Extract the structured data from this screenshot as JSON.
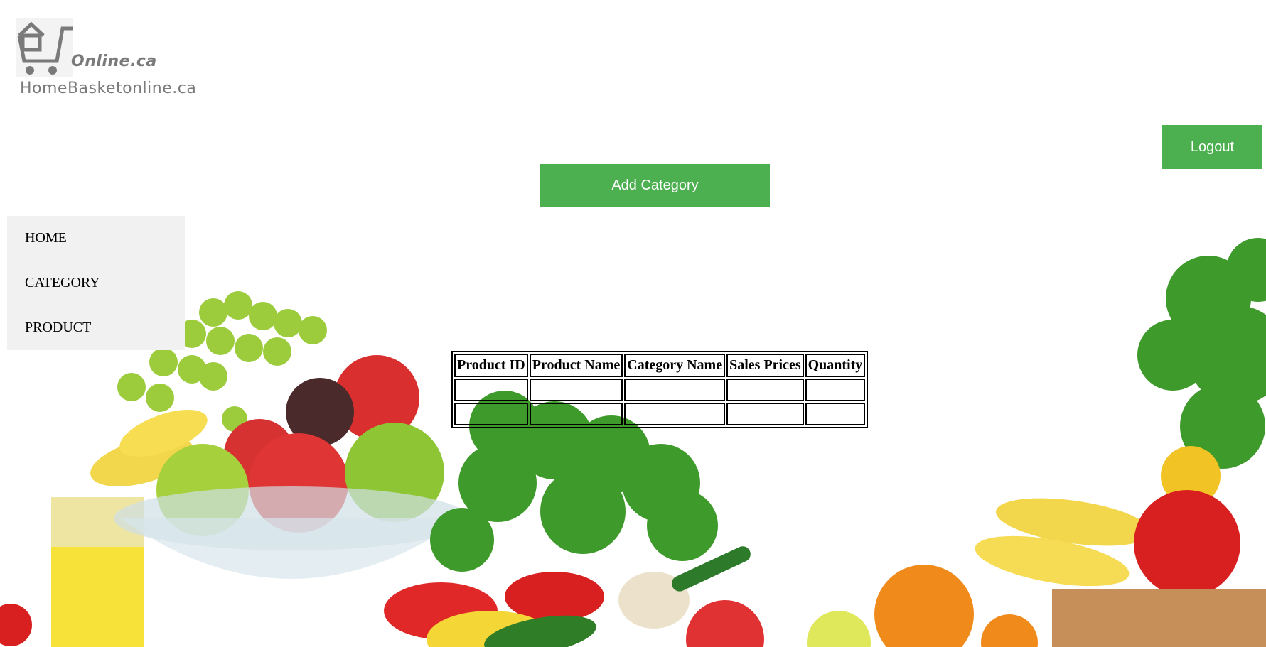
{
  "logo": {
    "tagline": "Online.ca",
    "brand": "HomeBasketonline.ca"
  },
  "buttons": {
    "logout": "Logout",
    "add_category": "Add Category"
  },
  "nav": {
    "items": [
      {
        "label": "HOME"
      },
      {
        "label": "CATEGORY"
      },
      {
        "label": "PRODUCT"
      }
    ]
  },
  "table": {
    "headers": [
      "Product ID",
      "Product Name",
      "Category Name",
      "Sales Prices",
      "Quantity"
    ],
    "rows": [
      [
        "",
        "",
        "",
        "",
        ""
      ],
      [
        "",
        "",
        "",
        "",
        ""
      ]
    ]
  },
  "colors": {
    "accent": "#4caf50",
    "nav_bg": "#f1f1f1",
    "logo_gray": "#7a7a7a"
  },
  "icons": {
    "logo": "house-cart-icon"
  }
}
